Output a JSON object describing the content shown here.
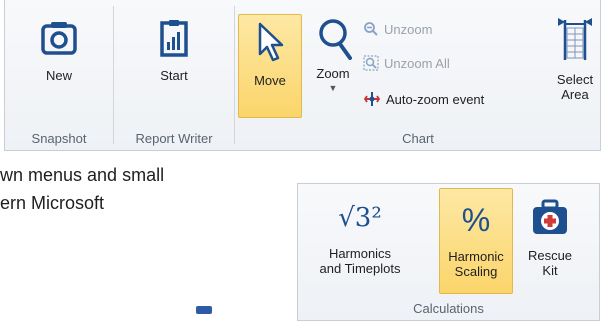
{
  "ribbon": {
    "snapshot": {
      "label": "Snapshot",
      "new_label": "New"
    },
    "report_writer": {
      "label": "Report Writer",
      "start_label": "Start"
    },
    "chart": {
      "label": "Chart",
      "move_label": "Move",
      "zoom_label": "Zoom",
      "unzoom_label": "Unzoom",
      "unzoom_all_label": "Unzoom All",
      "auto_zoom_label": "Auto-zoom event",
      "select_area_line1": "Select",
      "select_area_line2": "Area"
    }
  },
  "body": {
    "line1": "wn menus and small",
    "line2": "ern Microsoft"
  },
  "calculations": {
    "label": "Calculations",
    "harmonics_line1": "Harmonics",
    "harmonics_line2": "and Timeplots",
    "harmonic_scaling_line1": "Harmonic",
    "harmonic_scaling_line2": "Scaling",
    "rescue_line1": "Rescue",
    "rescue_line2": "Kit",
    "sqrt_glyph": "√3²",
    "percent_glyph": "%"
  },
  "colors": {
    "accent": "#1e4f8f",
    "active_bg": "#fbd56b",
    "icon_red": "#d33a3a"
  }
}
